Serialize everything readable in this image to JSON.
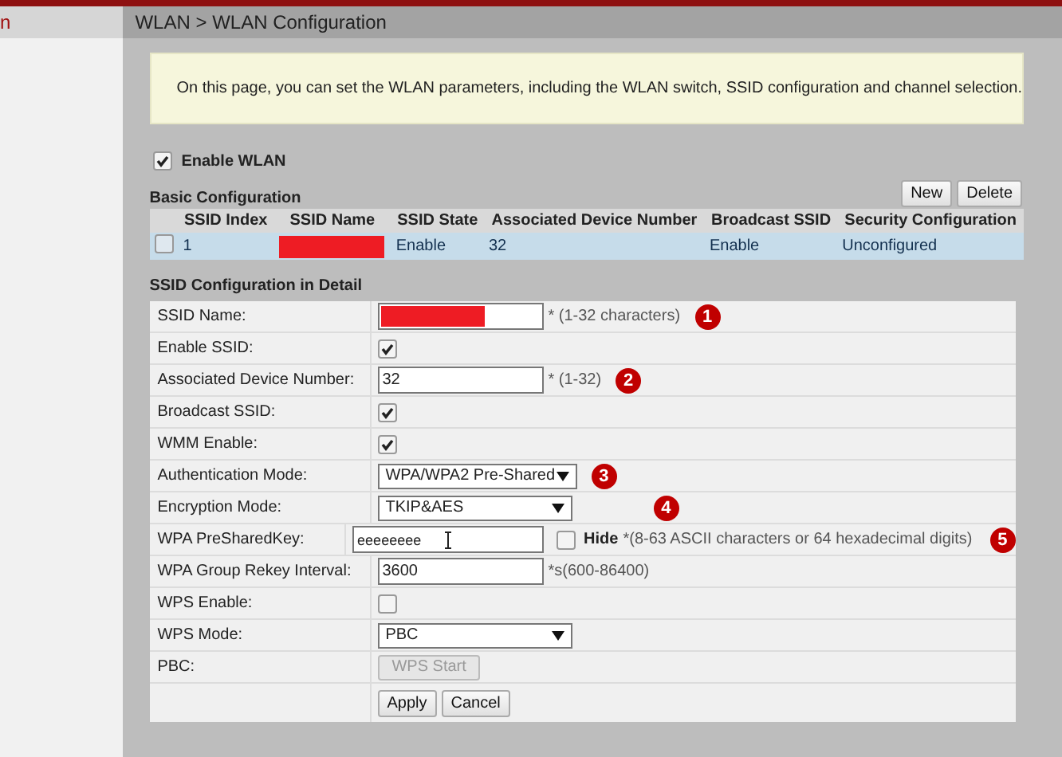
{
  "sidebar": {
    "title": "n"
  },
  "breadcrumb": "WLAN > WLAN Configuration",
  "notice": "On this page, you can set the WLAN parameters, including the WLAN switch, SSID configuration and channel selection.",
  "enable_wlan": {
    "label": "Enable WLAN",
    "checked": true
  },
  "basic": {
    "title": "Basic Configuration",
    "buttons": [
      "New",
      "Delete"
    ],
    "columns": [
      "SSID Index",
      "SSID Name",
      "SSID State",
      "Associated Device Number",
      "Broadcast SSID",
      "Security Configuration"
    ],
    "rows": [
      {
        "checked": false,
        "selected": true,
        "cells": [
          "1",
          "",
          "Enable",
          "32",
          "Enable",
          "Unconfigured"
        ]
      }
    ]
  },
  "detail": {
    "title": "SSID Configuration in Detail",
    "rows": [
      {
        "kind": "text",
        "label": "SSID Name:",
        "value": "",
        "hint": "* (1-32 characters)",
        "marker": "1"
      },
      {
        "kind": "checkbox",
        "label": "Enable SSID:",
        "checked": true
      },
      {
        "kind": "text",
        "label": "Associated Device Number:",
        "value": "32",
        "hint": "* (1-32)",
        "marker": "2"
      },
      {
        "kind": "checkbox",
        "label": "Broadcast SSID:",
        "checked": true
      },
      {
        "kind": "checkbox",
        "label": "WMM Enable:",
        "checked": true
      },
      {
        "kind": "select",
        "label": "Authentication Mode:",
        "value": "WPA/WPA2 Pre-Shared",
        "marker": "3"
      },
      {
        "kind": "select",
        "label": "Encryption Mode:",
        "value": "TKIP&AES",
        "marker": "4"
      },
      {
        "kind": "password",
        "label": "WPA PreSharedKey:",
        "value": "eeeeeeee",
        "hide_label": "Hide",
        "hide_checked": false,
        "hint": "*(8-63 ASCII characters or 64 hexadecimal digits)",
        "marker": "5"
      },
      {
        "kind": "text",
        "label": "WPA Group Rekey Interval:",
        "value": "3600",
        "hint": "*s(600-86400)"
      },
      {
        "kind": "checkbox",
        "label": "WPS Enable:",
        "checked": false
      },
      {
        "kind": "select",
        "label": "WPS Mode:",
        "value": "PBC"
      },
      {
        "kind": "button",
        "label": "PBC:",
        "value": "WPS Start",
        "disabled": true
      }
    ],
    "buttons": [
      "Apply",
      "Cancel"
    ]
  }
}
